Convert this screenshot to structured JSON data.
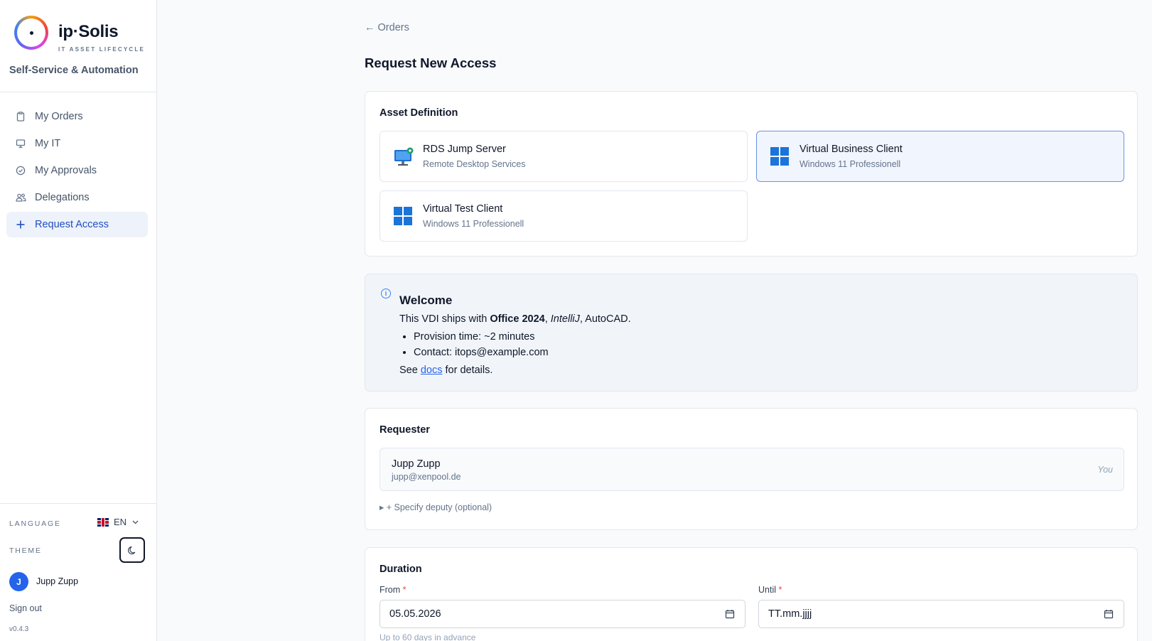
{
  "brand": {
    "name": "ip·Solis",
    "tagline": "IT ASSET LIFECYCLE",
    "subtitle": "Self-Service & Automation"
  },
  "nav": {
    "items": [
      {
        "label": "My Orders",
        "icon": "clipboard-icon"
      },
      {
        "label": "My IT",
        "icon": "monitor-icon"
      },
      {
        "label": "My Approvals",
        "icon": "check-circle-icon"
      },
      {
        "label": "Delegations",
        "icon": "users-icon"
      },
      {
        "label": "Request Access",
        "icon": "plus-icon",
        "active": true
      }
    ]
  },
  "sidebar_footer": {
    "language_label": "LANGUAGE",
    "language_value": "EN",
    "theme_label": "THEME",
    "user_initial": "J",
    "user_name": "Jupp Zupp",
    "sign_out": "Sign out",
    "version": "v0.4.3"
  },
  "main": {
    "back_label": "← Orders",
    "title": "Request New Access",
    "asset_definition": {
      "title": "Asset Definition",
      "assets": [
        {
          "name": "RDS Jump Server",
          "sub": "Remote Desktop Services",
          "icon": "rds-monitor-icon",
          "selected": false
        },
        {
          "name": "Virtual Business Client",
          "sub": "Windows 11 Professionell",
          "icon": "windows-icon",
          "selected": true
        },
        {
          "name": "Virtual Test Client",
          "sub": "Windows 11 Professionell",
          "icon": "windows-icon",
          "selected": false
        }
      ]
    },
    "info": {
      "title": "Welcome",
      "line1_prefix": "This VDI ships with ",
      "line1_bold": "Office 2024",
      "line1_sep": ", ",
      "line1_italic": "IntelliJ",
      "line1_suffix": ", AutoCAD.",
      "bullets": [
        "Provision time: ~2 minutes",
        "Contact: itops@example.com"
      ],
      "footer_prefix": "See ",
      "footer_link": "docs",
      "footer_suffix": " for details."
    },
    "requester": {
      "title": "Requester",
      "name": "Jupp Zupp",
      "email": "jupp@xenpool.de",
      "you_label": "You",
      "deputy_toggle": "▸ + Specify deputy (optional)"
    },
    "duration": {
      "title": "Duration",
      "from_label": "From",
      "from_value": "05.05.2026",
      "until_label": "Until",
      "until_value": "TT.mm.jjjj",
      "required_mark": "*",
      "hint": "Up to 60 days in advance"
    }
  },
  "colors": {
    "accent": "#1e4fc2",
    "selected_bg": "#f1f5fd",
    "windows_blue": "#1b74d9",
    "required": "#ef4444"
  }
}
